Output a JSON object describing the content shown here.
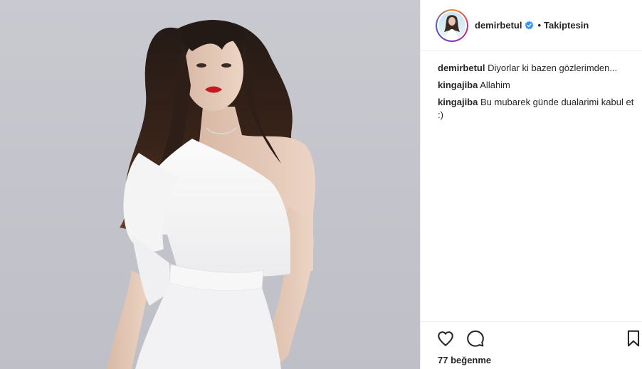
{
  "post": {
    "photo_description_icon": "portrait-photo",
    "author": {
      "username": "demirbetul",
      "verified": true,
      "separator": "•",
      "follow_status": "Takiptesin"
    },
    "comments": [
      {
        "user": "demirbetul",
        "text": "Diyorlar ki bazen gözlerimden..."
      },
      {
        "user": "kingajiba",
        "text": "Allahim"
      },
      {
        "user": "kingajiba",
        "text": "Bu mubarek günde dualarimi kabul et :)"
      }
    ],
    "actions": {
      "like_icon": "heart-icon",
      "comment_icon": "comment-icon",
      "save_icon": "bookmark-icon"
    },
    "likes": {
      "count": "77",
      "label": "beğenme"
    }
  },
  "colors": {
    "verified_badge": "#3897f0",
    "text": "#262626",
    "divider": "#efefef"
  }
}
